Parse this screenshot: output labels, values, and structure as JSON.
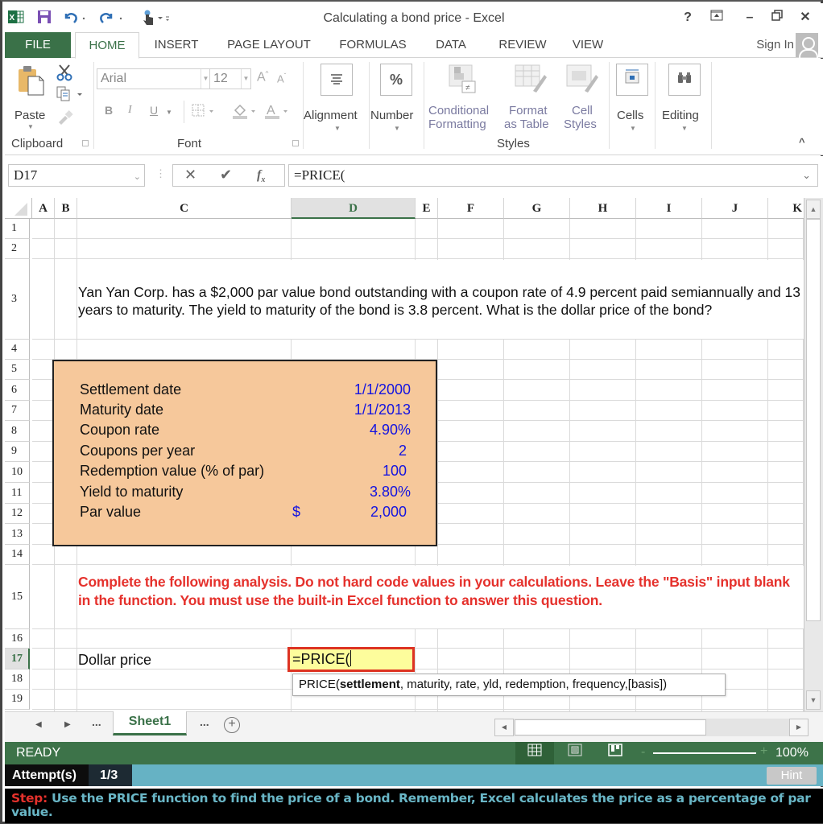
{
  "window": {
    "title": "Calculating a bond price - Excel",
    "controls": {
      "help": "?",
      "ribbon_display": "⤒",
      "minimize": "–",
      "restore": "❐",
      "close": "✕"
    }
  },
  "qat": {
    "icons": [
      "excel-logo-icon",
      "save-icon",
      "undo-icon",
      "redo-icon",
      "touch-mode-icon",
      "customize-qat-icon"
    ]
  },
  "tabs": [
    {
      "label": "FILE"
    },
    {
      "label": "HOME",
      "active": true
    },
    {
      "label": "INSERT"
    },
    {
      "label": "PAGE LAYOUT"
    },
    {
      "label": "FORMULAS"
    },
    {
      "label": "DATA"
    },
    {
      "label": "REVIEW"
    },
    {
      "label": "VIEW"
    }
  ],
  "account": {
    "sign_in": "Sign In"
  },
  "ribbon": {
    "clipboard": {
      "paste": "Paste",
      "group_label": "Clipboard"
    },
    "font": {
      "font_name": "Arial",
      "font_size": "12",
      "bold": "B",
      "italic": "I",
      "underline": "U",
      "group_label": "Font"
    },
    "alignment": {
      "label": "Alignment"
    },
    "number": {
      "label": "Number",
      "icon_text": "%"
    },
    "styles": {
      "conditional_formatting_1": "Conditional",
      "conditional_formatting_2": "Formatting",
      "format_table_1": "Format",
      "format_table_2": "as Table",
      "cell_styles_1": "Cell",
      "cell_styles_2": "Styles",
      "group_label": "Styles"
    },
    "cells": {
      "label": "Cells"
    },
    "editing": {
      "label": "Editing"
    }
  },
  "formula_bar": {
    "name_box": "D17",
    "formula": "=PRICE("
  },
  "grid": {
    "columns": [
      "A",
      "B",
      "C",
      "D",
      "E",
      "F",
      "G",
      "H",
      "I",
      "J",
      "K"
    ],
    "selected_column": "D",
    "rows": [
      "1",
      "2",
      "3",
      "4",
      "5",
      "6",
      "7",
      "8",
      "9",
      "10",
      "11",
      "12",
      "13",
      "14",
      "15",
      "16",
      "17",
      "18",
      "19"
    ],
    "selected_row": "17"
  },
  "sheet": {
    "question": "Yan Yan Corp. has a $2,000 par value bond outstanding with a coupon rate of 4.9 percent paid semiannually and 13 years to maturity. The yield to maturity of the bond is 3.8 percent. What is the dollar price of the bond?",
    "inputs": [
      {
        "label": "Settlement date",
        "value": "1/1/2000"
      },
      {
        "label": "Maturity date",
        "value": "1/1/2013"
      },
      {
        "label": "Coupon rate",
        "value": "4.90%"
      },
      {
        "label": "Coupons per year",
        "value": "2"
      },
      {
        "label": "Redemption value (% of par)",
        "value": "100"
      },
      {
        "label": "Yield to maturity",
        "value": "3.80%"
      },
      {
        "label": "Par value",
        "currency": "$",
        "value": "2,000"
      }
    ],
    "instruction": "Complete the following analysis. Do not hard code values in your calculations.  Leave the \"Basis\" input blank in the function. You must use the built-in Excel function to answer this question.",
    "answer_label": "Dollar price",
    "answer_cell": "=PRICE(",
    "tooltip": {
      "fn": "PRICE(",
      "current_arg": "settlement",
      "rest": ", maturity, rate, yld, redemption, frequency,[basis])"
    }
  },
  "sheet_tabs": {
    "ellipsis_left": "...",
    "active": "Sheet1",
    "ellipsis_right": "...",
    "add": "+"
  },
  "status": {
    "mode": "READY",
    "zoom": "100%",
    "zoom_minus": "-",
    "zoom_plus": "+"
  },
  "assessment": {
    "attempts_label": "Attempt(s)",
    "attempts_value": "1/3",
    "hint": "Hint",
    "step_prefix": "Step:",
    "step_text": " Use the PRICE function to find the price of a bond. Remember, Excel calculates the price as a percentage of par value."
  },
  "colors": {
    "excel_green": "#3a7148",
    "status_green": "#3d7349",
    "input_blue": "#1414e0",
    "instruction_red": "#e5312c",
    "box_fill": "#f6c89b",
    "attempt_bar": "#66b2c4",
    "step_text": "#69b6c6"
  }
}
